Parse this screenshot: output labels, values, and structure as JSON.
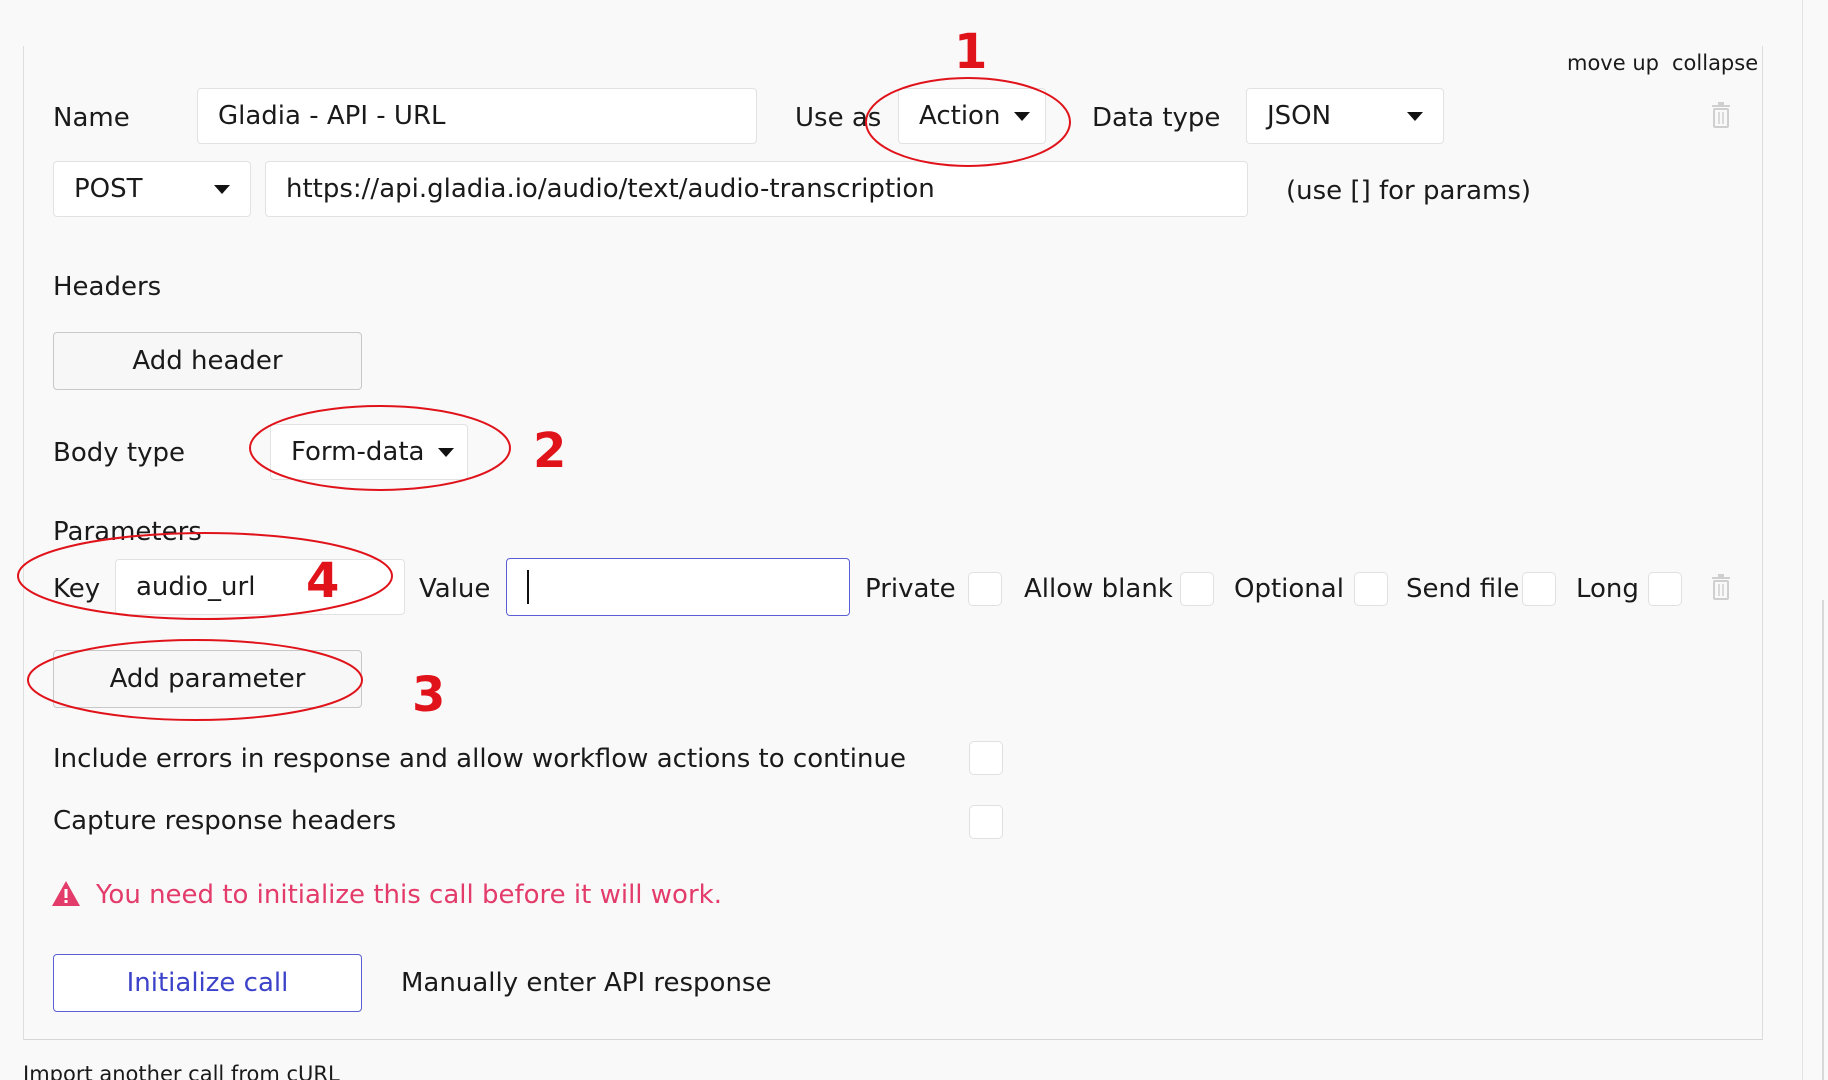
{
  "header": {
    "move_up": "move up",
    "collapse": "collapse"
  },
  "call": {
    "name_label": "Name",
    "name_value": "Gladia - API - URL",
    "use_as_label": "Use as",
    "use_as_value": "Action",
    "data_type_label": "Data type",
    "data_type_value": "JSON",
    "method_value": "POST",
    "url_value": "https://api.gladia.io/audio/text/audio-transcription",
    "url_hint": "(use [] for params)"
  },
  "headers": {
    "title": "Headers",
    "add_button": "Add header"
  },
  "body": {
    "label": "Body type",
    "value": "Form-data"
  },
  "parameters": {
    "title": "Parameters",
    "key_label": "Key",
    "key_value": "audio_url",
    "value_label": "Value",
    "value_value": "",
    "private_label": "Private",
    "allow_blank_label": "Allow blank",
    "optional_label": "Optional",
    "send_file_label": "Send file",
    "long_label": "Long",
    "add_button": "Add parameter"
  },
  "options": {
    "include_errors": "Include errors in response and allow workflow actions to continue",
    "capture_headers": "Capture response headers"
  },
  "warning": {
    "text": "You need to initialize this call before it will work."
  },
  "actions": {
    "initialize": "Initialize call",
    "manual": "Manually enter API response"
  },
  "footer": {
    "import_text": "Import another call from cURL"
  },
  "annotations": {
    "one": "1",
    "two": "2",
    "three": "3",
    "four": "4",
    "color": "#e0131b"
  },
  "colors": {
    "accent": "#5a5fd6",
    "warning": "#e33c6b"
  }
}
